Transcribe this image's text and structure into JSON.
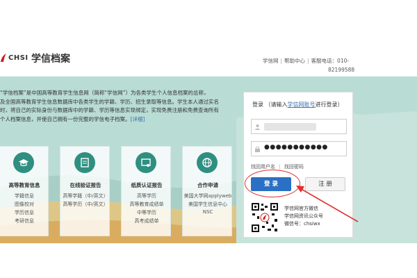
{
  "header": {
    "logo_text": "CHSI",
    "site_title": "学信档案",
    "links": [
      "学信网",
      "帮助中心",
      "客服电话：010-"
    ],
    "phone_cont": "82199588"
  },
  "hero": {
    "intro_lines": [
      "“学信档案”是中国高等教育学生信息网（简称“学信网”）为各类学生个人信息档案的总称，",
      "及全国高等教育学生信息数据库中各类学生的学籍、学历、招生录取等信息。学生本人通过实名",
      "时，将自己的实际身份与数据库中的学籍、学历等信息实现绑定，实现免费注册和免费查询所有",
      "个人档案信息，并使自己拥有一份完整的学信电子档案。"
    ],
    "detail_link": "[详细]"
  },
  "cards": [
    {
      "title": "高等教育信息",
      "items": [
        "学籍信息",
        "图像校对",
        "学历信息",
        "考研信息"
      ],
      "icon": "graduation-cap-icon"
    },
    {
      "title": "在线验证报告",
      "items": [
        "高等学籍（中/英文）",
        "高等学历（中/英文）"
      ],
      "icon": "report-icon"
    },
    {
      "title": "纸质认证报告",
      "items": [
        "高等学历",
        "高等教育成绩单",
        "中等学历",
        "高考成绩单"
      ],
      "icon": "certificate-icon"
    },
    {
      "title": "合作申请",
      "items": [
        "美国大学网applyweb",
        "美国学生信息中心",
        "NSC"
      ],
      "icon": "globe-icon"
    }
  ],
  "login": {
    "label": "登录",
    "hint_prefix": "（请输入",
    "hint_link": "学信网账号",
    "hint_suffix": "进行登录）",
    "password_value": "●●●●●●●●●●●",
    "forgot_user": "找回用户名",
    "forgot_pw": "找回密码",
    "login_btn": "登 录",
    "register_btn": "注 册"
  },
  "wechat": {
    "lines": [
      "学信网官方微信",
      "学信网资讯公众号",
      "微信号：chsiwx"
    ]
  },
  "colors": {
    "hero_bg": "#b9dcd5",
    "accent": "#2b70c4",
    "icon_bg": "#2f8f80",
    "annotation": "#e03030"
  }
}
